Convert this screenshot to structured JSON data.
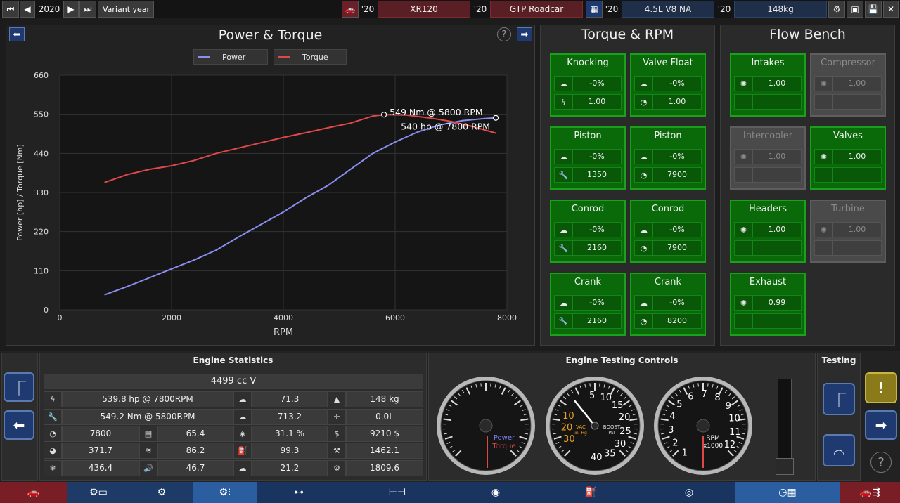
{
  "topbar": {
    "year": "2020",
    "variant_label": "Variant year",
    "year_short_1": "'20",
    "car_name": "XR120",
    "year_short_2": "'20",
    "car_class": "GTP Roadcar",
    "year_short_3": "'20",
    "engine_name": "4.5L V8 NA",
    "year_short_4": "'20",
    "weight": "148kg"
  },
  "power_panel": {
    "title": "Power & Torque",
    "help": "?",
    "legend": [
      {
        "name": "Power",
        "color": "#8a8ef0"
      },
      {
        "name": "Torque",
        "color": "#e04848"
      }
    ]
  },
  "chart_data": {
    "type": "line",
    "xlabel": "RPM",
    "ylabel": "Power [hp] / Torque [Nm]",
    "xlim": [
      0,
      8000
    ],
    "ylim": [
      0,
      660
    ],
    "x_ticks": [
      0,
      2000,
      4000,
      6000,
      8000
    ],
    "y_ticks": [
      0,
      110,
      220,
      330,
      440,
      550,
      660
    ],
    "grid": true,
    "legend_position": "top-center",
    "series": [
      {
        "name": "Power",
        "color": "#8a8ef0",
        "x": [
          800,
          1200,
          1600,
          2000,
          2400,
          2800,
          3200,
          3600,
          4000,
          4400,
          4800,
          5200,
          5600,
          6000,
          6400,
          6800,
          7200,
          7600,
          7800
        ],
        "y": [
          42,
          65,
          90,
          115,
          140,
          168,
          205,
          240,
          275,
          315,
          350,
          395,
          440,
          472,
          500,
          520,
          532,
          538,
          540
        ]
      },
      {
        "name": "Torque",
        "color": "#e04848",
        "x": [
          800,
          1200,
          1600,
          2000,
          2400,
          2800,
          3200,
          3600,
          4000,
          4400,
          4800,
          5200,
          5600,
          5800,
          6200,
          6600,
          7000,
          7400,
          7800
        ],
        "y": [
          358,
          380,
          395,
          405,
          420,
          440,
          455,
          470,
          485,
          498,
          512,
          525,
          545,
          549,
          548,
          540,
          530,
          515,
          497
        ]
      }
    ],
    "annotations": [
      {
        "text": "549 Nm @ 5800 RPM",
        "x": 5800,
        "y": 549
      },
      {
        "text": "540 hp @ 7800 RPM",
        "x": 7800,
        "y": 540
      }
    ]
  },
  "torque_rpm_panel": {
    "title": "Torque & RPM",
    "cards": [
      {
        "title": "Knocking",
        "rows": [
          {
            "icon": "cloud-icon",
            "value": "-0%"
          },
          {
            "icon": "lightning-icon",
            "value": "1.00"
          }
        ]
      },
      {
        "title": "Valve Float",
        "rows": [
          {
            "icon": "cloud-icon",
            "value": "-0%"
          },
          {
            "icon": "gauge-icon",
            "value": "1.00"
          }
        ]
      },
      {
        "title": "Piston",
        "rows": [
          {
            "icon": "cloud-icon",
            "value": "-0%"
          },
          {
            "icon": "wrench-icon",
            "value": "1350"
          }
        ]
      },
      {
        "title": "Piston",
        "rows": [
          {
            "icon": "cloud-icon",
            "value": "-0%"
          },
          {
            "icon": "gauge-icon",
            "value": "7900"
          }
        ]
      },
      {
        "title": "Conrod",
        "rows": [
          {
            "icon": "cloud-icon",
            "value": "-0%"
          },
          {
            "icon": "wrench-icon",
            "value": "2160"
          }
        ]
      },
      {
        "title": "Conrod",
        "rows": [
          {
            "icon": "cloud-icon",
            "value": "-0%"
          },
          {
            "icon": "gauge-icon",
            "value": "7900"
          }
        ]
      },
      {
        "title": "Crank",
        "rows": [
          {
            "icon": "cloud-icon",
            "value": "-0%"
          },
          {
            "icon": "wrench-icon",
            "value": "2160"
          }
        ]
      },
      {
        "title": "Crank",
        "rows": [
          {
            "icon": "cloud-icon",
            "value": "-0%"
          },
          {
            "icon": "gauge-icon",
            "value": "8200"
          }
        ]
      }
    ]
  },
  "flow_bench_panel": {
    "title": "Flow Bench",
    "cards": [
      {
        "title": "Intakes",
        "value": "1.00",
        "active": true
      },
      {
        "title": "Compressor",
        "value": "1.00",
        "active": false
      },
      {
        "title": "Intercooler",
        "value": "1.00",
        "active": false
      },
      {
        "title": "Valves",
        "value": "1.00",
        "active": true
      },
      {
        "title": "Headers",
        "value": "1.00",
        "active": true
      },
      {
        "title": "Turbine",
        "value": "1.00",
        "active": false
      },
      {
        "title": "Exhaust",
        "value": "0.99",
        "active": true
      }
    ]
  },
  "engine_stats": {
    "title": "Engine Statistics",
    "displacement": "4499 cc V",
    "rows": [
      [
        "539.8 hp @ 7800RPM",
        "71.3",
        "148 kg"
      ],
      [
        "549.2 Nm @ 5800RPM",
        "713.2",
        "0.0L"
      ],
      [
        "7800",
        "65.4",
        "31.1 %",
        "9210 $"
      ],
      [
        "371.7",
        "86.2",
        "99.3",
        "1462.1"
      ],
      [
        "436.4",
        "46.7",
        "21.2",
        "1809.6"
      ]
    ]
  },
  "testing_controls": {
    "title": "Engine Testing Controls",
    "gauge1": {
      "power_label": "Power",
      "torque_label": "Torque"
    },
    "gauge2": {
      "vac_label": "VAC",
      "vac_unit": "in. Hg",
      "boost_label": "BOOST",
      "boost_unit": "PSI",
      "vac_ticks": [
        "10",
        "20",
        "30"
      ],
      "boost_ticks": [
        "5",
        "10",
        "15",
        "20",
        "25",
        "30",
        "35",
        "40"
      ]
    },
    "gauge3": {
      "label": "RPM",
      "unit": "x1000",
      "ticks": [
        "1",
        "2",
        "3",
        "4",
        "5",
        "6",
        "7",
        "8",
        "9",
        "10",
        "11",
        "12"
      ]
    }
  },
  "testing": {
    "title": "Testing",
    "warn": "!",
    "help": "?"
  }
}
